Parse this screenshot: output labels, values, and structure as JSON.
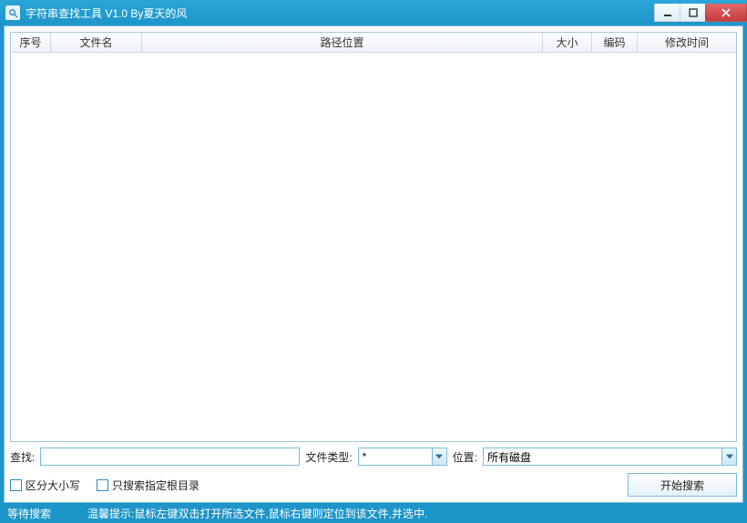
{
  "window": {
    "title": "字符串查找工具 V1.0 By夏天的风"
  },
  "table": {
    "headers": {
      "seq": "序号",
      "name": "文件名",
      "path": "路径位置",
      "size": "大小",
      "enc": "编码",
      "mtime": "修改时间"
    }
  },
  "controls": {
    "search_label": "查找:",
    "search_value": "",
    "filetype_label": "文件类型:",
    "filetype_value": "*",
    "location_label": "位置:",
    "location_value": "所有磁盘",
    "case_sensitive_label": "区分大小写",
    "root_only_label": "只搜索指定根目录",
    "start_button": "开始搜索"
  },
  "status": {
    "left": "等待搜索",
    "hint": "温馨提示:鼠标左键双击打开所选文件,鼠标右键则定位到该文件,并选中."
  }
}
